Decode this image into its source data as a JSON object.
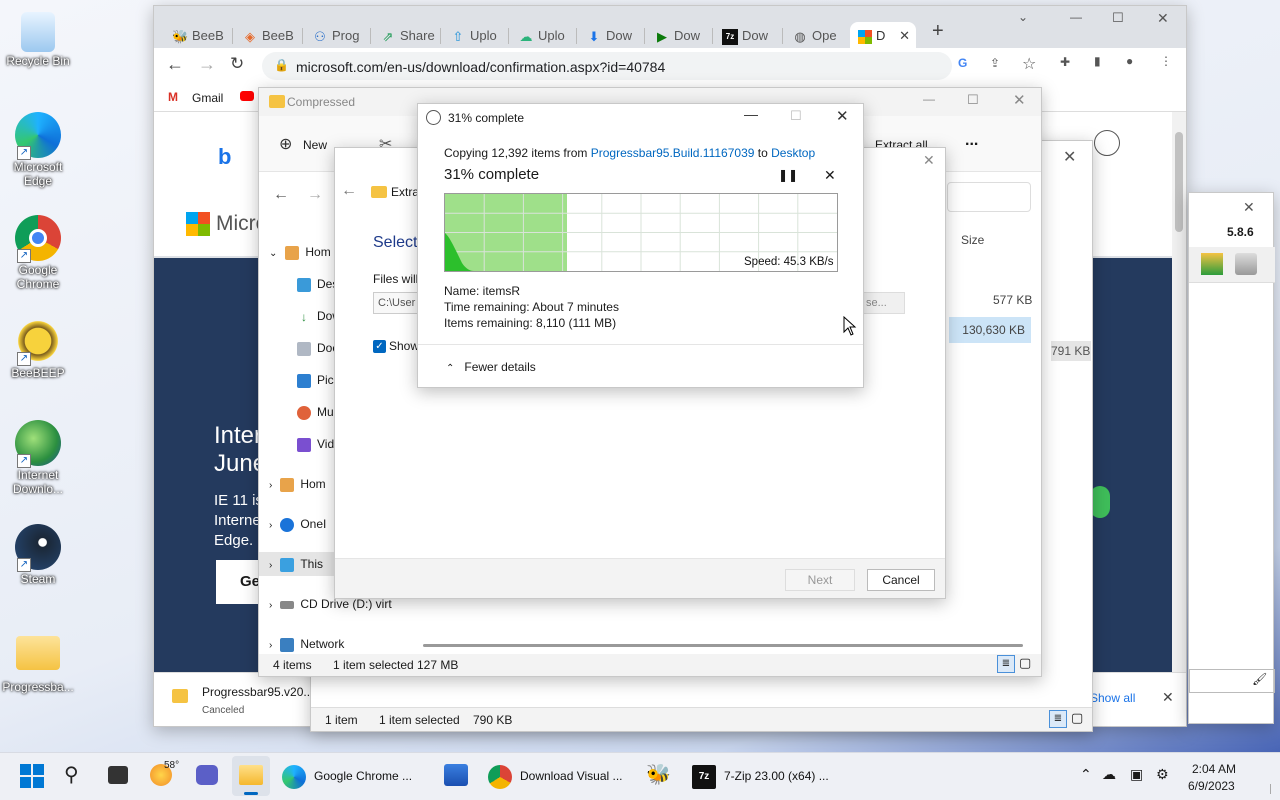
{
  "desktop": {
    "icons": [
      {
        "label": "Recycle Bin"
      },
      {
        "label": "Microsoft Edge"
      },
      {
        "label": "Google Chrome"
      },
      {
        "label": "BeeBEEP"
      },
      {
        "label": "Internet Downlo..."
      },
      {
        "label": "Steam"
      },
      {
        "label": "Progressba..."
      }
    ]
  },
  "chrome": {
    "tabs": [
      {
        "label": "BeeB",
        "icon": "bee-icon"
      },
      {
        "label": "BeeB",
        "icon": "diamond-icon"
      },
      {
        "label": "Prog",
        "icon": "gamepad-icon"
      },
      {
        "label": "Share",
        "icon": "share-icon"
      },
      {
        "label": "Uplo",
        "icon": "upload-icon"
      },
      {
        "label": "Uplo",
        "icon": "upload-cloud-icon"
      },
      {
        "label": "Dow",
        "icon": "download-icon"
      },
      {
        "label": "Dow",
        "icon": "play-icon"
      },
      {
        "label": "Dow",
        "icon": "7zip-icon"
      },
      {
        "label": "Ope",
        "icon": "globe-icon"
      },
      {
        "label": "D",
        "icon": "microsoft-icon"
      }
    ],
    "url": "microsoft.com/en-us/download/confirmation.aspx?id=40784",
    "bookmarks": [
      "Gmail"
    ],
    "page": {
      "heading1": "Inter",
      "heading2": "June",
      "body1": "IE 11 is",
      "body2": "Interne",
      "body3": "Edge.",
      "button": "Ge",
      "brand": "Micro"
    },
    "download": {
      "filename": "Progressbar95.v20...",
      "status": "Canceled"
    },
    "show_all": "Show all"
  },
  "explorer": {
    "title": "Compressed",
    "toolbar": {
      "new": "New",
      "extract_all": "Extract all",
      "more": "..."
    },
    "nav": [
      {
        "label": "Hom"
      },
      {
        "label": "Des"
      },
      {
        "label": "Dow"
      },
      {
        "label": "Doc"
      },
      {
        "label": "Pic"
      },
      {
        "label": "Mu"
      },
      {
        "label": "Vid"
      },
      {
        "label": "Hom"
      },
      {
        "label": "OneI"
      },
      {
        "label": "This"
      },
      {
        "label": "CD Drive (D:) virt"
      },
      {
        "label": "Network"
      }
    ],
    "size_header": "Size",
    "sizes": [
      "577 KB",
      "130,630 KB"
    ],
    "status": {
      "items": "4 items",
      "selected": "1 item selected",
      "size": "127 MB"
    }
  },
  "explorer2": {
    "status": {
      "items": "1 item",
      "selected": "1 item selected",
      "size": "790 KB"
    },
    "side_size": "791 KB"
  },
  "extract_wizard": {
    "title": "Extra",
    "heading": "Select",
    "files_label": "Files will",
    "path": "C:\\User",
    "browse": "se...",
    "show_label": "Show",
    "next": "Next",
    "cancel": "Cancel"
  },
  "sevenzip": {
    "version": "5.8.6"
  },
  "copy_dialog": {
    "window_title": "31% complete",
    "copying_prefix": "Copying 12,392 items from",
    "source": "Progressbar95.Build.11167039",
    "to": "to",
    "destination": "Desktop",
    "percent_label": "31% complete",
    "progress": 0.31,
    "speed": "Speed: 45.3 KB/s",
    "name": "Name:  itemsR",
    "time_remaining": "Time remaining:  About 7 minutes",
    "items_remaining": "Items remaining:  8,110 (111 MB)",
    "fewer_details": "Fewer details"
  },
  "taskbar": {
    "weather": "58°",
    "apps": [
      {
        "label": "Google Chrome ..."
      },
      {
        "label": "Download Visual ..."
      },
      {
        "label": "7-Zip 23.00 (x64) ..."
      }
    ],
    "time": "2:04 AM",
    "date": "6/9/2023"
  },
  "colors": {
    "accent": "#0067c0",
    "progress": "#9fe08a",
    "progress_dark": "#2cbf2c"
  }
}
